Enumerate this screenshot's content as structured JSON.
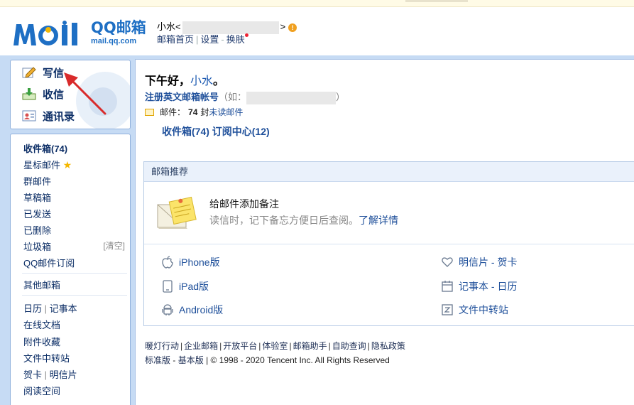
{
  "logo": {
    "brand_line1": "QQ邮箱",
    "brand_line2": "mail.qq.com"
  },
  "user": {
    "name": "小水",
    "open": "<",
    "close": ">",
    "home_link": "邮箱首页",
    "settings_link": "设置",
    "skin_link": "换肤",
    "sep": "|",
    "dash": "-"
  },
  "actions": {
    "compose": "写信",
    "inbox": "收信",
    "contacts": "通讯录"
  },
  "folders": {
    "inbox": "收件箱(74)",
    "starred": "星标邮件",
    "group": "群邮件",
    "drafts": "草稿箱",
    "sent": "已发送",
    "deleted": "已删除",
    "spam": "垃圾箱",
    "spam_clear": "[清空]",
    "subscriptions": "QQ邮件订阅",
    "other": "其他邮箱",
    "calendar": "日历",
    "notes": "记事本",
    "docs": "在线文档",
    "attachments": "附件收藏",
    "transfer": "文件中转站",
    "cards": "贺卡",
    "postcards": "明信片",
    "reading": "阅读空间",
    "sep": "|"
  },
  "main": {
    "greeting": "下午好，",
    "greeting_name": "小水",
    "greeting_end": "。",
    "register": "注册英文邮箱帐号",
    "register_hint_open": "（如：",
    "register_hint_close": "）",
    "unread_prefix": "邮件：",
    "unread_count": "74",
    "unread_unit": "封",
    "unread_link": "未读邮件",
    "inbox_link": "收件箱(74)",
    "subscribe_link": "订阅中心(12)"
  },
  "recommend": {
    "title": "邮箱推荐",
    "note_title": "给邮件添加备注",
    "note_desc": "读信时，记下备忘方便日后查阅。",
    "note_link": "了解详情",
    "apps": {
      "iphone": "iPhone版",
      "ipad": "iPad版",
      "android": "Android版",
      "postcard": "明信片 - 贺卡",
      "notebook": "记事本 - 日历",
      "transfer": "文件中转站"
    }
  },
  "footer": {
    "links": [
      "暖灯行动",
      "企业邮箱",
      "开放平台",
      "体验室",
      "邮箱助手",
      "自助查询",
      "隐私政策"
    ],
    "standard": "标准版",
    "basic": "基本版",
    "dash": "-",
    "sep": "|",
    "copyright": "© 1998 - 2020 Tencent Inc. All Rights Reserved"
  },
  "colors": {
    "brand": "#1e6fc4",
    "link": "#1e4f9a",
    "frame": "#c6dbf4",
    "warn": "#f0a020",
    "arrow": "#d92b2b"
  },
  "icons": [
    "pencil-icon",
    "download-icon",
    "contacts-icon",
    "warning-icon",
    "star-icon",
    "envelope-icon",
    "sticky-note-icon",
    "apple-icon",
    "ipad-icon",
    "android-icon",
    "heart-icon",
    "calendar-icon",
    "transfer-icon"
  ]
}
